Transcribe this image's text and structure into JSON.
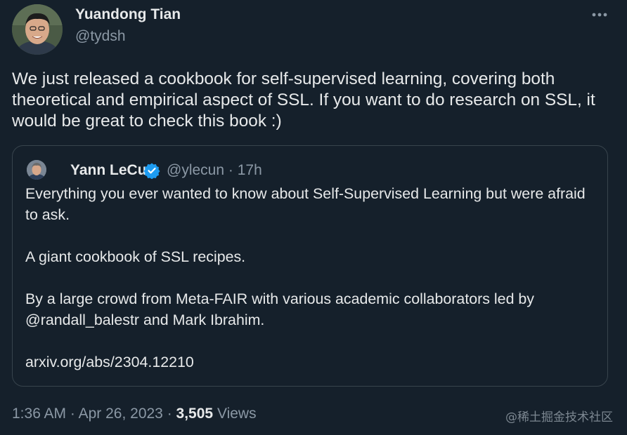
{
  "tweet": {
    "author_name": "Yuandong Tian",
    "author_handle": "@tydsh",
    "more_icon": "more-horizontal-icon",
    "text": "We just released a cookbook for self-supervised learning, covering both theoretical and empirical aspect of SSL. If you want to do research on SSL, it would be great to check this book :)"
  },
  "quote": {
    "author_name": "Yann LeCun",
    "verified_icon": "verified-badge-icon",
    "author_handle": "@ylecun",
    "separator": "·",
    "time": "17h",
    "paragraphs": [
      "Everything you ever wanted to know about Self-Supervised Learning but were afraid to ask.",
      "A giant cookbook of SSL recipes.",
      "By a large crowd from Meta-FAIR with various academic collaborators led by @randall_balestr and Mark Ibrahim.",
      "arxiv.org/abs/2304.12210"
    ]
  },
  "meta": {
    "time": "1:36 AM",
    "separator": "·",
    "date": "Apr 26, 2023",
    "views_count": "3,505",
    "views_label": "Views"
  },
  "watermark": "@稀土掘金技术社区",
  "colors": {
    "background": "#15202b",
    "text_primary": "#e7e9ea",
    "text_secondary": "#8b98a5",
    "border": "#38444d",
    "verified": "#1d9bf0"
  }
}
